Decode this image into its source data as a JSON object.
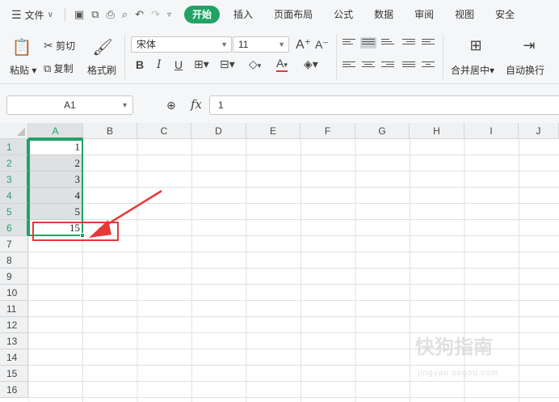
{
  "menu": {
    "file_label": "文件",
    "tabs": [
      "开始",
      "插入",
      "页面布局",
      "公式",
      "数据",
      "审阅",
      "视图",
      "安全"
    ],
    "active_tab": "开始"
  },
  "ribbon": {
    "paste_label": "粘贴",
    "cut_label": "剪切",
    "copy_label": "复制",
    "format_painter_label": "格式刷",
    "font_name": "宋体",
    "font_size": "11",
    "merge_label": "合并居中",
    "wrap_label": "自动换行"
  },
  "formula_bar": {
    "name_box": "A1",
    "fx_label": "fx",
    "value": "1"
  },
  "grid": {
    "columns": [
      "A",
      "B",
      "C",
      "D",
      "E",
      "F",
      "G",
      "H",
      "I",
      "J"
    ],
    "rows": [
      "1",
      "2",
      "3",
      "4",
      "5",
      "6",
      "7",
      "8",
      "9",
      "10",
      "11",
      "12",
      "13",
      "14",
      "15",
      "16"
    ],
    "cells_A": [
      "1",
      "2",
      "3",
      "4",
      "5",
      "15"
    ]
  },
  "watermark": {
    "text": "快狗指南",
    "sub": "jingyan.sogou.com"
  },
  "colors": {
    "accent": "#21a366",
    "annotation": "#e53935"
  }
}
